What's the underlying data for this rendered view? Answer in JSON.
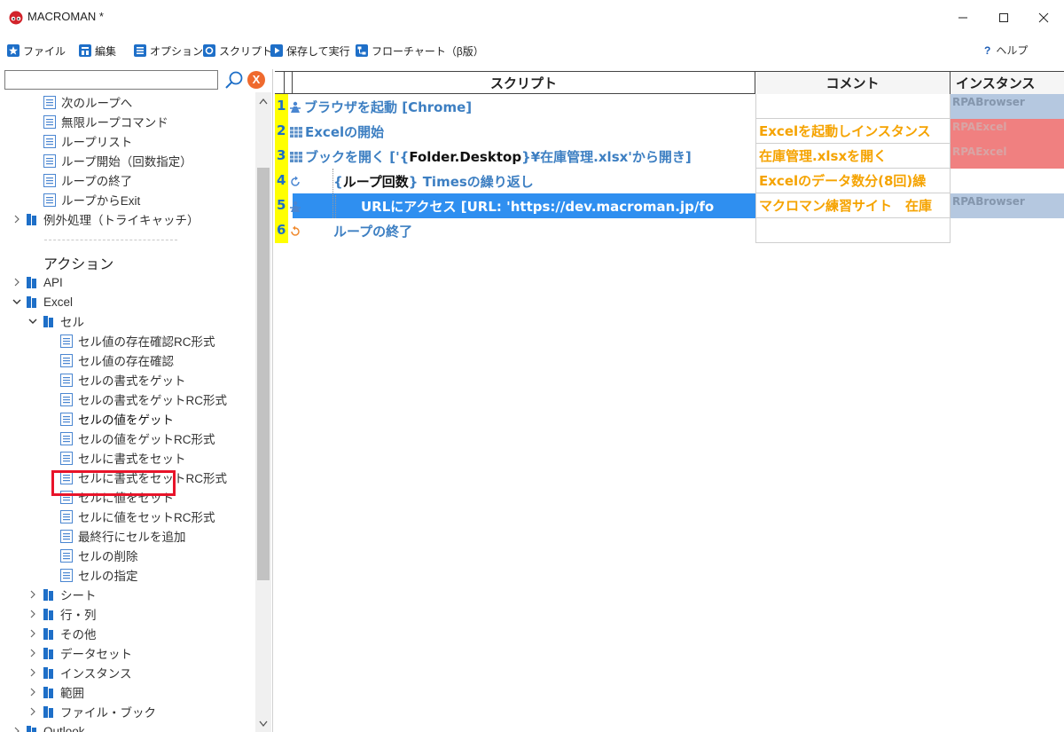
{
  "window": {
    "title": "MACROMAN *"
  },
  "toolbar": {
    "items": [
      {
        "label": "ファイル",
        "icon": "star-icon"
      },
      {
        "label": "編集",
        "icon": "edit-icon"
      },
      {
        "label": "オプション",
        "icon": "list-icon"
      },
      {
        "label": "スクリプト",
        "icon": "script-icon"
      },
      {
        "label": "保存して実行",
        "icon": "play-icon"
      },
      {
        "label": "フローチャート（β版）",
        "icon": "flowchart-icon"
      }
    ],
    "help_label": "ヘルプ",
    "help_mark": "?"
  },
  "search": {
    "value": "",
    "placeholder": "",
    "clear_label": "X"
  },
  "tree": {
    "loop_items": [
      "次のループへ",
      "無限ループコマンド",
      "ループリスト",
      "ループ開始（回数指定）",
      "ループの終了",
      "ループからExit"
    ],
    "exception_folder": "例外処理（トライキャッチ）",
    "actions_heading": "アクション",
    "api_folder": "API",
    "excel_folder": "Excel",
    "cell_folder": "セル",
    "cell_items": [
      "セル値の存在確認RC形式",
      "セル値の存在確認",
      "セルの書式をゲット",
      "セルの書式をゲットRC形式",
      "セルの値をゲット",
      "セルの値をゲットRC形式",
      "セルに書式をセット",
      "セルに書式をセットRC形式",
      "セルに値をセット",
      "セルに値をセットRC形式",
      "最終行にセルを追加",
      "セルの削除",
      "セルの指定"
    ],
    "excel_subfolders": [
      "シート",
      "行・列",
      "その他",
      "データセット",
      "インスタンス",
      "範囲",
      "ファイル・ブック"
    ],
    "outlook_folder": "Outlook",
    "highlighted_item": "セルの値をゲット"
  },
  "grid": {
    "headers": {
      "script": "スクリプト",
      "comment": "コメント",
      "instance": "インスタンス"
    },
    "rows": [
      {
        "num": "1",
        "script": "ブラウザを起動 [Chrome]",
        "comment": "",
        "instance": "RPABrowser"
      },
      {
        "num": "2",
        "script": "Excelの開始",
        "comment": "Excelを起動しインスタンス",
        "instance": "RPAExcel"
      },
      {
        "num": "3",
        "script_pre": "ブックを開く ['{",
        "script_var": "Folder.Desktop",
        "script_post": "}¥在庫管理.xlsx'から開き]",
        "comment": "在庫管理.xlsxを開く",
        "instance": "RPAExcel"
      },
      {
        "num": "4",
        "script_pre": "{",
        "script_var": "ループ回数",
        "script_post": "} Timesの繰り返し",
        "comment": "Excelのデータ数分(8回)繰",
        "instance": ""
      },
      {
        "num": "5",
        "script": "URLにアクセス [URL: 'https://dev.macroman.jp/fo",
        "comment": "マクロマン練習サイト　在庫",
        "instance": "RPABrowser"
      },
      {
        "num": "6",
        "script": "ループの終了",
        "comment": "",
        "instance": ""
      }
    ]
  },
  "colors": {
    "accent_blue": "#3d7fc2",
    "comment_orange": "#f5a300",
    "selection_blue": "#2f8ff0",
    "browser_instance_bg": "#b5c8e0",
    "excel_instance_bg": "#f08080",
    "row_number_bg": "#ffff00",
    "highlight_red": "#e8142a"
  }
}
